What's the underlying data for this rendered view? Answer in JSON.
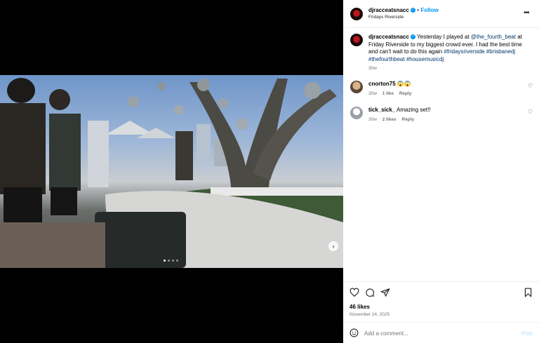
{
  "post": {
    "username": "djracceatsnacc",
    "follow_label": "Follow",
    "separator": "•",
    "location": "Fridays Riverside",
    "caption": {
      "text_1": "Yesterday I played at ",
      "mention": "@the_fourth_beat",
      "text_2": " at Friday Riverside to my biggest crowd ever. I had the best time and can't wait to do this again ",
      "hashtags": "#fridaysriverside #brisbanedj #thefourthbeat #housemusicdj",
      "time": "30w"
    },
    "likes": "46 likes",
    "date": "November 24, 2025"
  },
  "comments": [
    {
      "username": "cnorton75",
      "text": "😱😱",
      "time": "30w",
      "likes": "1 like",
      "reply": "Reply"
    },
    {
      "username": "tick_sick_",
      "text": "Amazing set!!",
      "time": "30w",
      "likes": "2 likes",
      "reply": "Reply"
    }
  ],
  "composer": {
    "placeholder": "Add a comment...",
    "post_label": "Post"
  },
  "icons": {
    "more": "more-options-icon",
    "heart": "heart-icon",
    "comment": "comment-icon",
    "share": "share-icon",
    "save": "bookmark-icon",
    "emoji": "emoji-icon",
    "next": "chevron-right-icon",
    "tag": "user-tag-icon",
    "sound": "speaker-icon"
  },
  "carousel": {
    "count": 4,
    "active_index": 0
  },
  "colors": {
    "accent": "#0095f6",
    "link": "#00376b",
    "muted": "#737373"
  }
}
